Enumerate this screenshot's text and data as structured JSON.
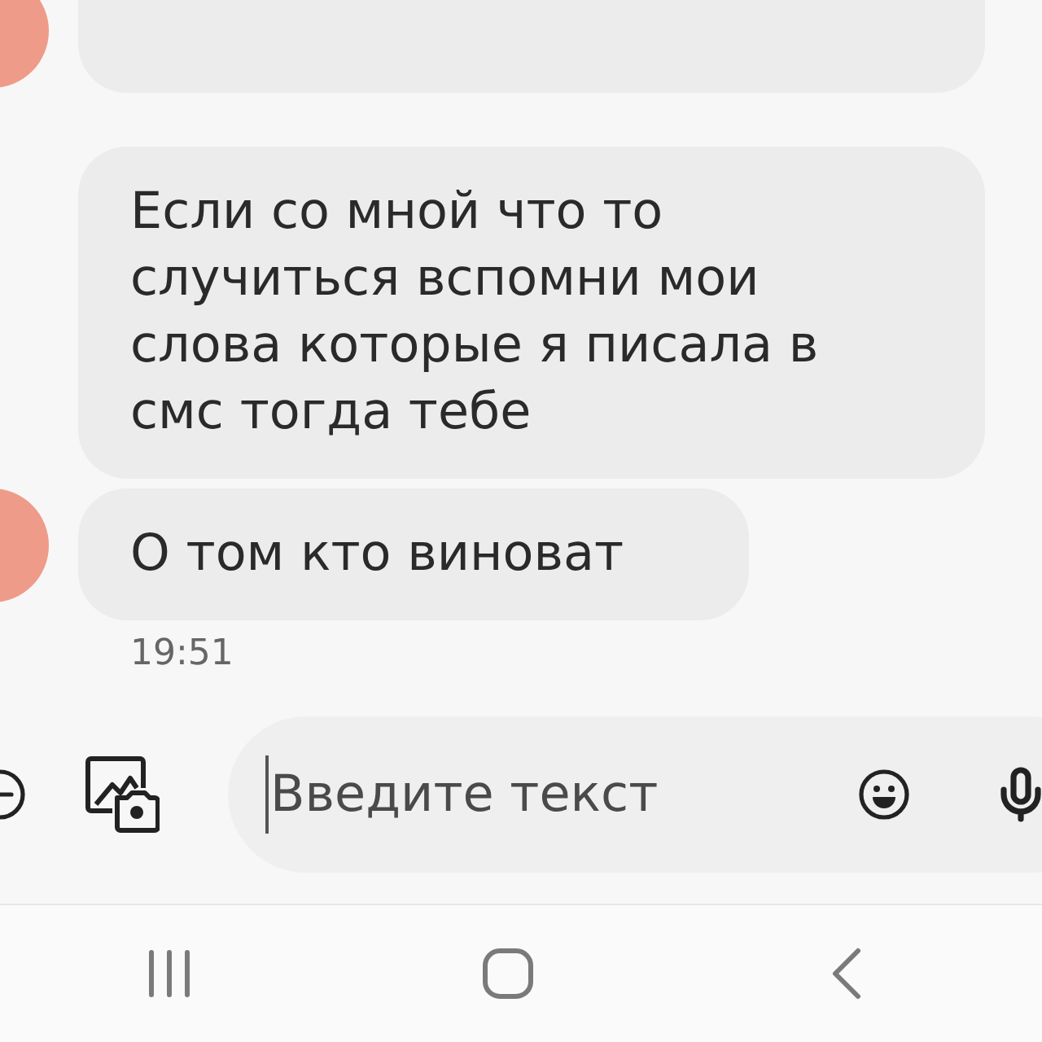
{
  "conversation": {
    "messages": [
      {
        "avatar": true
      },
      {
        "avatar": false,
        "text": "Если со мной что то случиться вспомни мои слова которые я писала в смс тогда тебе"
      },
      {
        "avatar": true,
        "text": "О том кто виноват",
        "time": "19:51"
      }
    ]
  },
  "composer": {
    "placeholder": "Введите текст",
    "focused": true
  }
}
